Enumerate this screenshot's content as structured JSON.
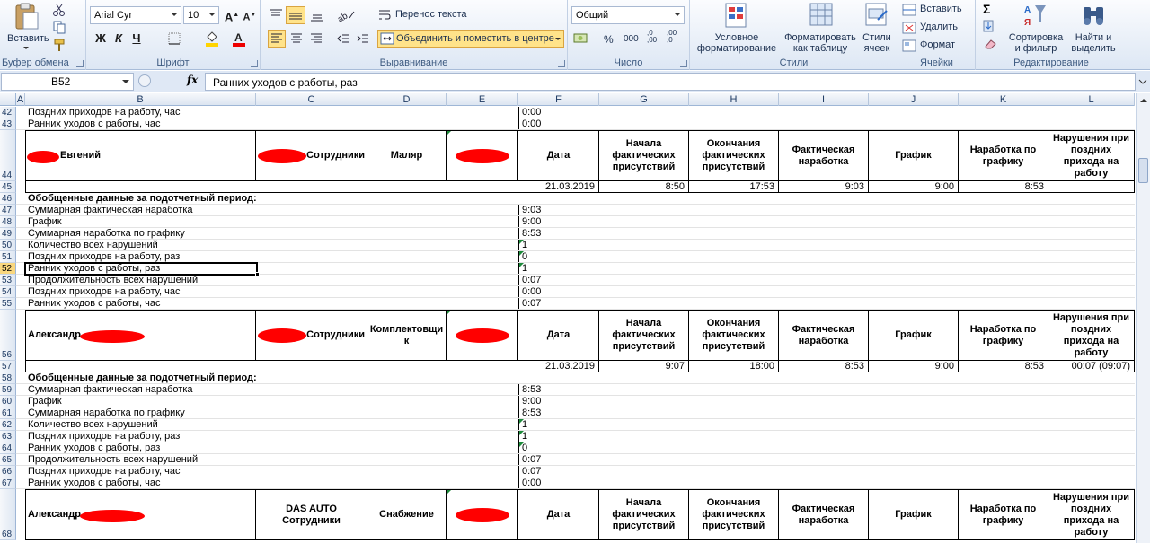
{
  "ribbon": {
    "clipboard": {
      "label": "Буфер обмена",
      "paste": "Вставить"
    },
    "font": {
      "label": "Шрифт",
      "name": "Arial Cyr",
      "size": "10",
      "bold": "Ж",
      "italic": "К",
      "underline": "Ч"
    },
    "alignment": {
      "label": "Выравнивание",
      "wrap": "Перенос текста",
      "merge": "Объединить и поместить в центре"
    },
    "number": {
      "label": "Число",
      "format": "Общий",
      "percent": "%",
      "thousands": "000",
      "inc": ",0\n,00",
      "dec": ",00\n,0"
    },
    "styles": {
      "label": "Стили",
      "conditional": "Условное\nформатирование",
      "as_table": "Форматировать\nкак таблицу",
      "cell_styles": "Стили\nячеек"
    },
    "cells": {
      "label": "Ячейки",
      "insert": "Вставить",
      "delete": "Удалить",
      "format": "Формат"
    },
    "editing": {
      "label": "Редактирование",
      "sort": "Сортировка\nи фильтр",
      "find": "Найти и\nвыделить"
    }
  },
  "formula_bar": {
    "name_box": "B52",
    "fx": "fx",
    "content": "Ранних уходов с работы, раз"
  },
  "columns": [
    "A",
    "B",
    "C",
    "D",
    "E",
    "F",
    "G",
    "H",
    "I",
    "J",
    "K",
    "L"
  ],
  "header_labels": {
    "employees": "Сотрудники",
    "das_employees": "DAS AUTO Сотрудники",
    "date": "Дата",
    "start": "Начала фактических присутствий",
    "end": "Окончания фактических присутствий",
    "actual": "Фактическая наработка",
    "schedule": "График",
    "by_schedule": "Наработка по графику",
    "violations": "Нарушения при поздних прихода на работу"
  },
  "rows": [
    {
      "n": "42",
      "b": "Поздних приходов на работу, час",
      "f": "0:00"
    },
    {
      "n": "43",
      "b": "Ранних уходов с работы, час",
      "f": "0:00"
    },
    {
      "n": "44",
      "name": "Евгений",
      "c": "Сотрудники",
      "d": "Маляр"
    },
    {
      "n": "45",
      "date": "21.03.2019",
      "g": "8:50",
      "h": "17:53",
      "i": "9:03",
      "j": "9:00",
      "k": "8:53",
      "l": ""
    },
    {
      "n": "46",
      "b": "Обобщенные данные за подотчетный период:",
      "bold": true
    },
    {
      "n": "47",
      "b": "Суммарная фактическая наработка",
      "f": "9:03"
    },
    {
      "n": "48",
      "b": "График",
      "f": "9:00"
    },
    {
      "n": "49",
      "b": "Суммарная наработка по графику",
      "f": "8:53"
    },
    {
      "n": "50",
      "b": "Количество всех нарушений",
      "f": "1"
    },
    {
      "n": "51",
      "b": "Поздних приходов на работу, раз",
      "f": "0"
    },
    {
      "n": "52",
      "b": "Ранних уходов с работы, раз",
      "f": "1"
    },
    {
      "n": "53",
      "b": "Продолжительность всех нарушений",
      "f": "0:07"
    },
    {
      "n": "54",
      "b": "Поздних приходов на работу, час",
      "f": "0:00"
    },
    {
      "n": "55",
      "b": "Ранних уходов с работы, час",
      "f": "0:07"
    },
    {
      "n": "56",
      "name": "Александр",
      "c": "Сотрудники",
      "d": "Комплектовщи\nк"
    },
    {
      "n": "57",
      "date": "21.03.2019",
      "g": "9:07",
      "h": "18:00",
      "i": "8:53",
      "j": "9:00",
      "k": "8:53",
      "l": "00:07 (09:07)"
    },
    {
      "n": "58",
      "b": "Обобщенные данные за подотчетный период:",
      "bold": true
    },
    {
      "n": "59",
      "b": "Суммарная фактическая наработка",
      "f": "8:53"
    },
    {
      "n": "60",
      "b": "График",
      "f": "9:00"
    },
    {
      "n": "61",
      "b": "Суммарная наработка по графику",
      "f": "8:53"
    },
    {
      "n": "62",
      "b": "Количество всех нарушений",
      "f": "1"
    },
    {
      "n": "63",
      "b": "Поздних приходов на работу, раз",
      "f": "1"
    },
    {
      "n": "64",
      "b": "Ранних уходов с работы, раз",
      "f": "0"
    },
    {
      "n": "65",
      "b": "Продолжительность всех нарушений",
      "f": "0:07"
    },
    {
      "n": "66",
      "b": "Поздних приходов на работу, час",
      "f": "0:07"
    },
    {
      "n": "67",
      "b": "Ранних уходов с работы, час",
      "f": "0:00"
    },
    {
      "n": "68",
      "name": "Александр",
      "c": "DAS AUTO Сотрудники",
      "d": "Снабжение"
    }
  ]
}
